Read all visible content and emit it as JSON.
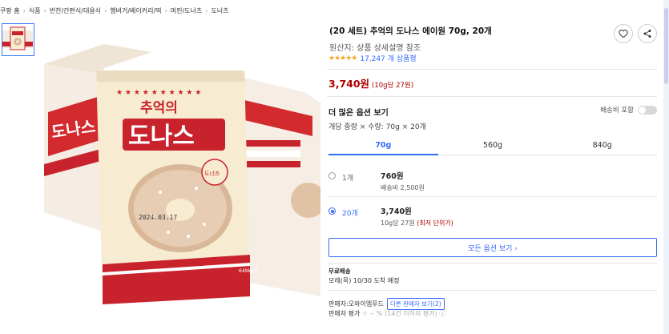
{
  "breadcrumb": [
    "쿠팡 홈",
    "식품",
    "반찬/간편식/대용식",
    "햄버거/베이커리/떡",
    "머핀/도너츠",
    "도너츠"
  ],
  "product": {
    "title": "(20 세트) 추억의 도나스 에이원 70g, 20개",
    "origin": "원산지: 상품 상세설명 참조",
    "stars": "★★★★★",
    "reviews": "17,247 개 상품평",
    "price": "3,740원",
    "unit_price": "(10g당 27원)"
  },
  "options": {
    "more_label": "더 많은 옵션 보기",
    "ship_include_label": "배송비 포함",
    "spec": "개당 중량 × 수량: 70g × 20개",
    "tabs": [
      "70g",
      "560g",
      "840g"
    ],
    "rows": [
      {
        "qty": "1개",
        "price": "760원",
        "sub": "배송비 2,500원",
        "best": ""
      },
      {
        "qty": "20개",
        "price": "3,740원",
        "sub": "10g당 27원",
        "best": "(최저 단위가)"
      }
    ],
    "all_button": "모든 옵션 보기 ›"
  },
  "delivery": {
    "free": "무료배송",
    "arrive": "모레(목) 10/30 도착 예정"
  },
  "seller": {
    "label": "판매자:",
    "name": "오와이엠푸드",
    "other_button": "다른 판매자 보기(2)",
    "rating_label": "판매자 평가",
    "rating_value": "☆ -- %",
    "rating_note": "(14건 이하의 평가) ⓘ"
  },
  "package_text": {
    "line1": "추억의",
    "line2": "도나스",
    "date": "2024.03.17",
    "badge": "도너츠",
    "kcal": "649kcal"
  },
  "colors": {
    "accent": "#346aff",
    "price": "#ae0000",
    "star": "#f5a623"
  }
}
